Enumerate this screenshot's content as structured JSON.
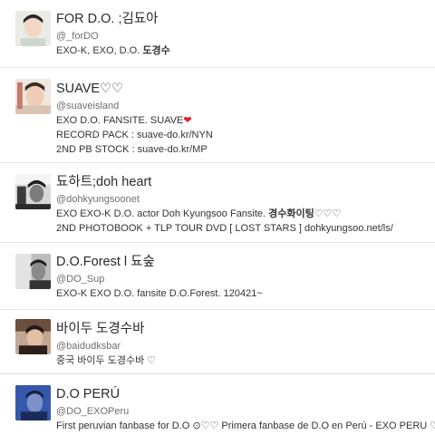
{
  "accounts": [
    {
      "name": "FOR D.O. ;김됴아",
      "handle": "@_forDO",
      "bio_lines": [
        "EXO-K, EXO, D.O. "
      ],
      "bio_bold": "도경수"
    },
    {
      "name": "SUAVE♡♡",
      "handle": "@suaveisland",
      "bio_lines": [
        "EXO D.O. FANSITE. SUAVE",
        "RECORD PACK : suave-do.kr/NYN",
        "2ND PB STOCK : suave-do.kr/MP"
      ],
      "bio_heart": "❤"
    },
    {
      "name": "됴하트;doh heart",
      "handle": "@dohkyungsoonet",
      "bio_lines": [
        "EXO EXO-K D.O. actor Doh Kyungsoo Fansite. ",
        "2ND PHOTOBOOK + TLP TOUR DVD [ LOST STARS ] dohkyungsoo.net/ls/"
      ],
      "bio_bold": "경수화이팅♡♡♡"
    },
    {
      "name": "D.O.Forest l 됴숲",
      "handle": "@DO_Sup",
      "bio_lines": [
        "EXO-K EXO D.O. fansite D.O.Forest. 120421~"
      ]
    },
    {
      "name": "바이두 도경수바",
      "handle": "@baidudksbar",
      "bio_lines": [
        "중국 바이두 도경수바 ♡"
      ]
    },
    {
      "name": "D.O PERÚ",
      "handle": "@DO_EXOPeru",
      "bio_lines": [
        "First peruvian fanbase for D.O ⊙♡♡ Primera fanbase de D.O en Perú - EXO PERU ♡~"
      ]
    }
  ]
}
